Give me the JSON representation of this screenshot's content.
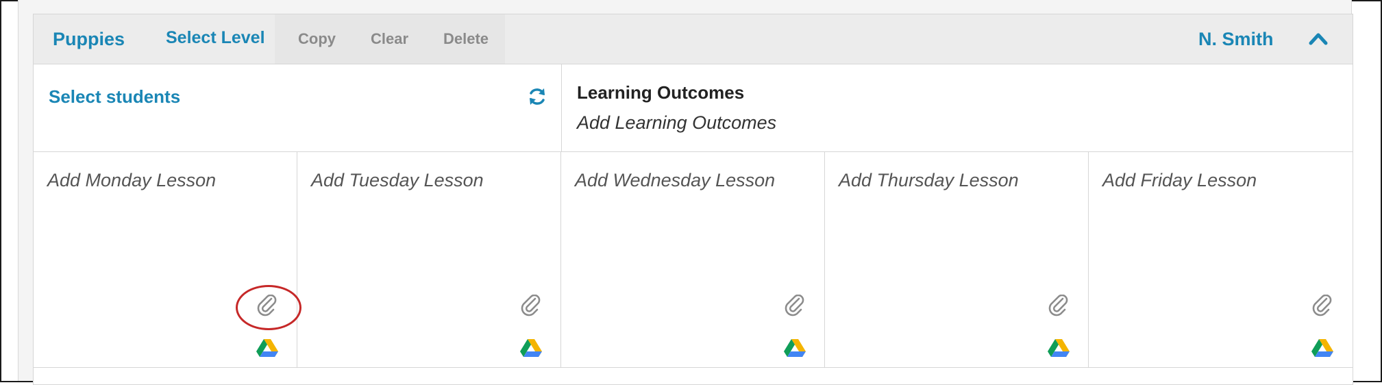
{
  "toolbar": {
    "group_name": "Puppies",
    "select_level": "Select Level",
    "copy": "Copy",
    "clear": "Clear",
    "delete": "Delete",
    "teacher": "N. Smith",
    "collapse_icon": "chevron-up-icon"
  },
  "students": {
    "label": "Select students",
    "refresh_icon": "refresh-icon"
  },
  "outcomes": {
    "title": "Learning Outcomes",
    "placeholder": "Add Learning Outcomes"
  },
  "days": [
    {
      "label": "Add Monday Lesson"
    },
    {
      "label": "Add Tuesday Lesson"
    },
    {
      "label": "Add Wednesday Lesson"
    },
    {
      "label": "Add Thursday Lesson"
    },
    {
      "label": "Add Friday Lesson"
    }
  ],
  "icons": {
    "attach": "paperclip-icon",
    "drive": "google-drive-icon"
  },
  "colors": {
    "accent": "#1a86b5",
    "muted": "#8a8a8a",
    "highlight": "#c62828"
  }
}
